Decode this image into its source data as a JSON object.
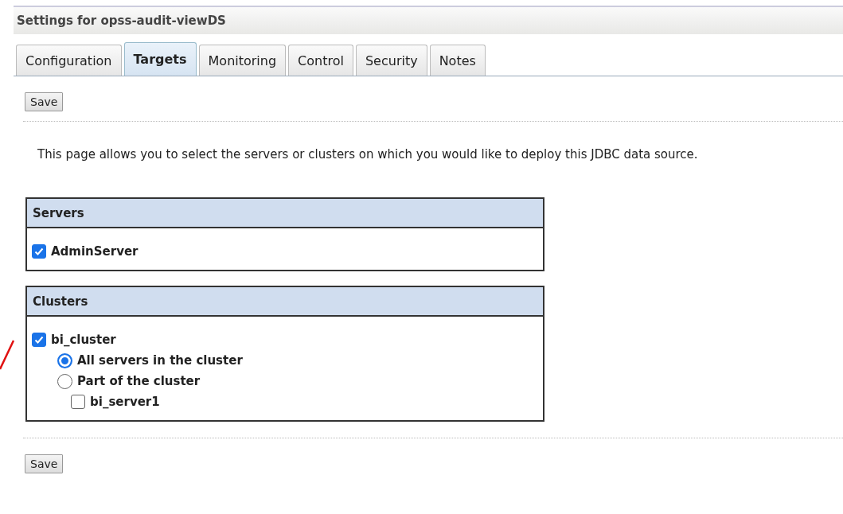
{
  "header": {
    "title": "Settings for opss-audit-viewDS"
  },
  "tabs": [
    {
      "label": "Configuration",
      "selected": false
    },
    {
      "label": "Targets",
      "selected": true
    },
    {
      "label": "Monitoring",
      "selected": false
    },
    {
      "label": "Control",
      "selected": false
    },
    {
      "label": "Security",
      "selected": false
    },
    {
      "label": "Notes",
      "selected": false
    }
  ],
  "top_button": "Save",
  "description": "This page allows you to select the servers or clusters on which you would like to deploy this JDBC data source.",
  "servers": {
    "title": "Servers",
    "items": [
      {
        "label": "AdminServer",
        "checked": true
      }
    ]
  },
  "clusters": {
    "title": "Clusters",
    "items": [
      {
        "label": "bi_cluster",
        "checked": true,
        "options": [
          {
            "label": "All servers in the cluster",
            "selected": true
          },
          {
            "label": "Part of the cluster",
            "selected": false,
            "members": [
              {
                "label": "bi_server1",
                "checked": false
              }
            ]
          }
        ]
      }
    ]
  },
  "bottom_button": "Save"
}
